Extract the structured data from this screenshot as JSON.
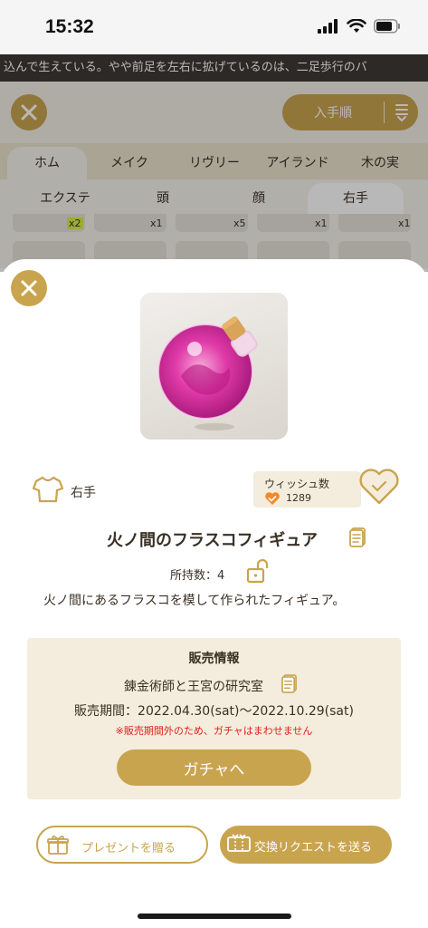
{
  "status_bar": {
    "time": "15:32"
  },
  "marquee": {
    "text": "込んで生えている。やや前足を左右に拡げているのは、二足歩行のバ"
  },
  "background": {
    "sort_label": "入手順",
    "tabs_row1": [
      "ホム",
      "メイク",
      "リヴリー",
      "アイランド",
      "木の実"
    ],
    "tabs_row2": [
      "エクステ",
      "頭",
      "顔",
      "右手"
    ],
    "item_counts": [
      "x2",
      "x1",
      "x5",
      "x1",
      "x1"
    ]
  },
  "item": {
    "category": "右手",
    "wish": {
      "label": "ウィッシュ数",
      "count": "1289"
    },
    "name": "火ノ間のフラスコフィギュア",
    "owned": "所持数：4",
    "description": "火ノ間にあるフラスコを模して作られたフィギュア。"
  },
  "sale": {
    "title": "販売情報",
    "shop": "錬金術師と王宮の研究室",
    "period": "販売期間：2022.04.30(sat)〜2022.10.29(sat)",
    "warning": "※販売期間外のため、ガチャはまわせません",
    "gacha_button": "ガチャへ"
  },
  "actions": {
    "gift_button": "プレゼントを贈る",
    "trade_button": "交換リクエストを送る"
  },
  "colors": {
    "accent": "#c9a44f",
    "panel": "#f4ecdc",
    "warning": "#e02020"
  }
}
